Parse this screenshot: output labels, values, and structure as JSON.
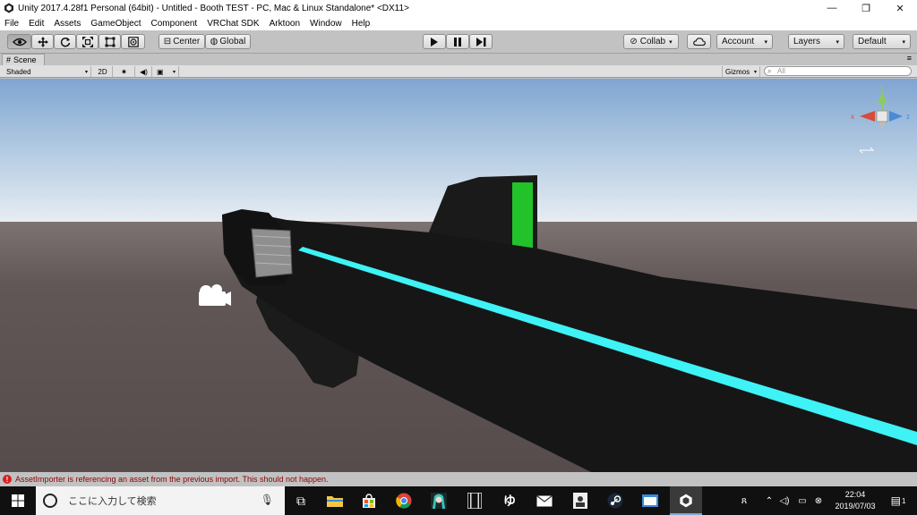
{
  "window": {
    "title": "Unity 2017.4.28f1 Personal (64bit) - Untitled - Booth TEST - PC, Mac & Linux Standalone* <DX11>",
    "minimize": "—",
    "maximize": "❐",
    "close": "✕"
  },
  "menu": [
    "File",
    "Edit",
    "Assets",
    "GameObject",
    "Component",
    "VRChat SDK",
    "Arktoon",
    "Window",
    "Help"
  ],
  "toolbar": {
    "center_label": "Center",
    "global_label": "Global",
    "collab_label": "Collab",
    "account_label": "Account",
    "layers_label": "Layers",
    "layout_label": "Default"
  },
  "scene": {
    "tab_label": "Scene",
    "shading_mode": "Shaded",
    "mode_2d": "2D",
    "gizmos_label": "Gizmos",
    "search_placeholder": "All",
    "gizmo_axis_y": "y",
    "gizmo_axis_x": "x",
    "gizmo_axis_z": "z"
  },
  "status": {
    "message": "AssetImporter is referencing an asset from the previous import. This should not happen."
  },
  "taskbar": {
    "search_placeholder": "ここに入力して検索",
    "time": "22:04",
    "date": "2019/07/03",
    "notification_count": "1"
  },
  "colors": {
    "editor_bg": "#c2c2c2",
    "sky_top": "#7fa5d2",
    "horizon": "#e8eef3",
    "ground": "#5a5050",
    "accent_cyan": "#3ef2f5",
    "accent_green": "#22c22a",
    "error_red": "#d62020",
    "taskbar": "#101010"
  }
}
